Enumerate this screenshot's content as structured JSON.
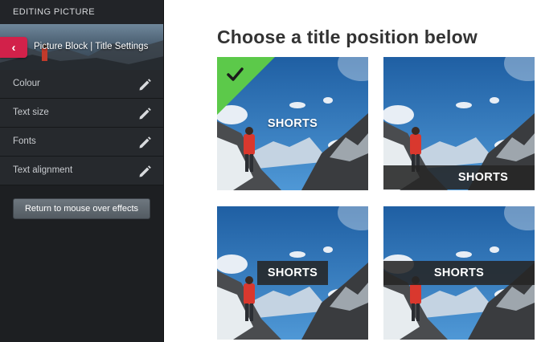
{
  "sidebar": {
    "title": "EDITING PICTURE",
    "header": {
      "back_icon": "chevron-left-icon",
      "label": "Picture Block | Title Settings"
    },
    "items": [
      {
        "label": "Colour",
        "icon": "pencil-icon"
      },
      {
        "label": "Text size",
        "icon": "pencil-icon"
      },
      {
        "label": "Fonts",
        "icon": "pencil-icon"
      },
      {
        "label": "Text alignment",
        "icon": "pencil-icon"
      }
    ],
    "return_button": "Return to mouse over effects"
  },
  "main": {
    "title": "Choose a title position below",
    "options": [
      {
        "label": "SHORTS",
        "position": "center",
        "selected": true
      },
      {
        "label": "SHORTS",
        "position": "bottom-right",
        "selected": false
      },
      {
        "label": "SHORTS",
        "position": "center-band",
        "selected": false
      },
      {
        "label": "SHORTS",
        "position": "full-band",
        "selected": false
      }
    ]
  },
  "colors": {
    "accent_back": "#d2214a",
    "selected_green": "#5cc94a",
    "sidebar_bg": "#1d1f22"
  }
}
